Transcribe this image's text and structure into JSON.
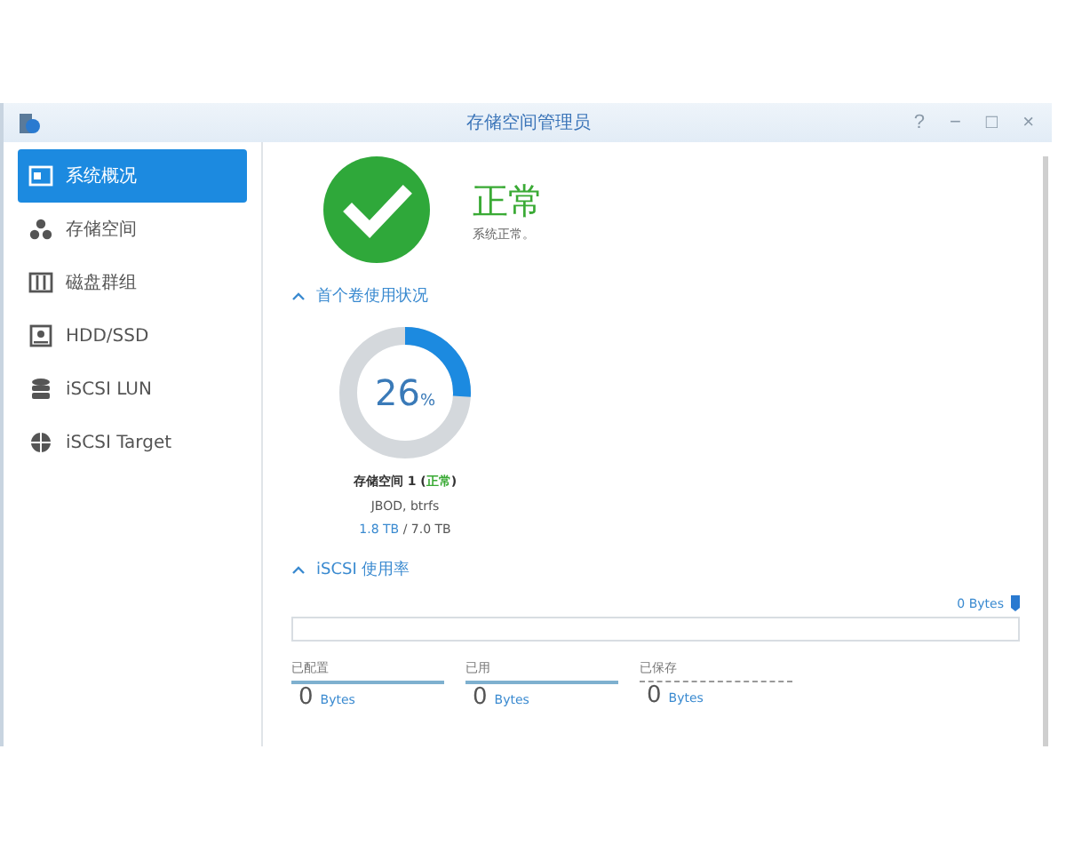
{
  "window": {
    "title": "存储空间管理员",
    "controls": [
      "?",
      "−",
      "□",
      "×"
    ]
  },
  "sidebar": {
    "items": [
      {
        "label": "系统概况",
        "selected": true
      },
      {
        "label": "存储空间",
        "selected": false
      },
      {
        "label": "磁盘群组",
        "selected": false
      },
      {
        "label": "HDD/SSD",
        "selected": false
      },
      {
        "label": "iSCSI LUN",
        "selected": false
      },
      {
        "label": "iSCSI Target",
        "selected": false
      }
    ]
  },
  "status": {
    "title": "正常",
    "description": "系统正常。"
  },
  "volume_section": {
    "title": "首个卷使用状况",
    "expanded": true,
    "percent": "26",
    "unit": "%",
    "level": 0.26,
    "name": "存储空间 1",
    "open": " (",
    "status": "正常",
    "close": ")",
    "info": "JBOD, btrfs",
    "used": "1.8 TB",
    "separator": " / ",
    "total": "7.0 TB"
  },
  "iscsi_section": {
    "title": "iSCSI 使用率",
    "expanded": true,
    "reading": "0 Bytes",
    "level": 0,
    "legend": [
      {
        "label": "已配置",
        "value": "0",
        "unit": "Bytes",
        "kind": "solid"
      },
      {
        "label": "已用",
        "value": "0",
        "unit": "Bytes",
        "kind": "solid"
      },
      {
        "label": "已保存",
        "value": "0",
        "unit": "Bytes",
        "kind": "dashed"
      }
    ]
  }
}
